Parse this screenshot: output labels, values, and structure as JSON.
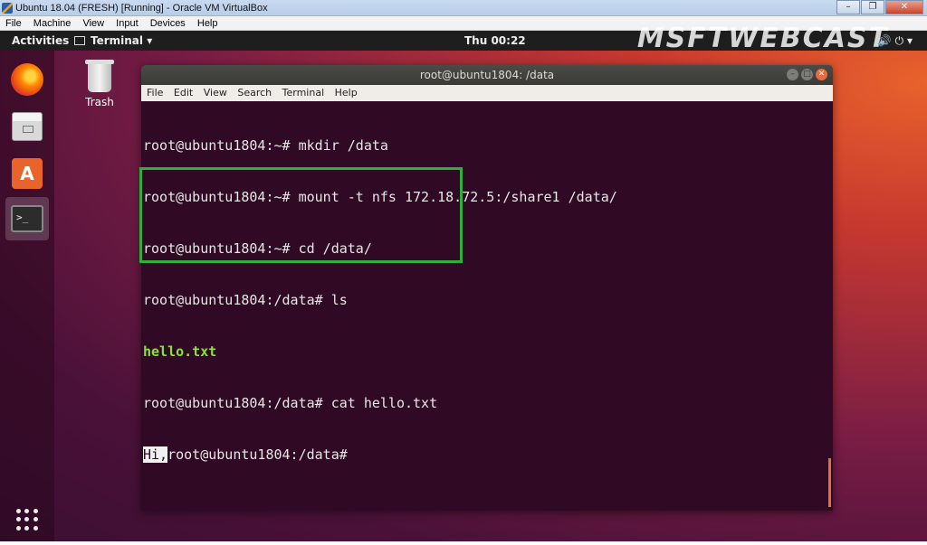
{
  "host": {
    "title": "Ubuntu 18.04 (FRESH) [Running] - Oracle VM VirtualBox",
    "menu": [
      "File",
      "Machine",
      "View",
      "Input",
      "Devices",
      "Help"
    ],
    "window_buttons": {
      "minimize": "–",
      "restore": "❐",
      "close": "✕"
    }
  },
  "topbar": {
    "activities": "Activities",
    "app_menu": "Terminal ▾",
    "clock": "Thu 00:22",
    "watermark": "MSFTWEBCAST",
    "system_icons": "🔊 ⏻ ▾"
  },
  "desktop": {
    "trash_label": "Trash"
  },
  "dock": {
    "items": [
      "firefox-icon",
      "files-icon",
      "software-icon",
      "terminal-icon"
    ],
    "terminal_glyph": ">_"
  },
  "terminal": {
    "title": "root@ubuntu1804: /data",
    "menu": [
      "File",
      "Edit",
      "View",
      "Search",
      "Terminal",
      "Help"
    ],
    "lines": [
      "root@ubuntu1804:~# mkdir /data",
      "root@ubuntu1804:~# mount -t nfs 172.18.72.5:/share1 /data/",
      "root@ubuntu1804:~# cd /data/",
      "root@ubuntu1804:/data# ls",
      "hello.txt",
      "root@ubuntu1804:/data# cat hello.txt"
    ],
    "last_line_selected": "Hi,",
    "last_line_rest": "root@ubuntu1804:/data#"
  },
  "colors": {
    "terminal_bg": "#300a24",
    "highlight_box": "#2eae3a",
    "ls_file": "#8ae234"
  }
}
